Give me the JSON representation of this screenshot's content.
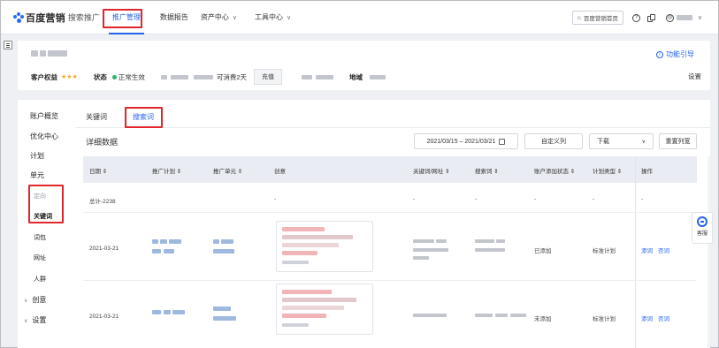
{
  "topnav": {
    "logo": "百度营销",
    "product": "搜索推广",
    "items": [
      {
        "label": "推广管理",
        "active": true
      },
      {
        "label": "数据报告"
      },
      {
        "label": "资产中心"
      },
      {
        "label": "工具中心"
      }
    ],
    "home_button": "百度营销首页",
    "help_icon": "?"
  },
  "account": {
    "benefit_label": "客户权益",
    "stars": "★★★",
    "status_label": "状态",
    "status_value": "正常生效",
    "days_left": "可消费2天",
    "recharge_button": "充值",
    "region_label": "地域",
    "guide_link": "功能引导",
    "settings_link": "设置"
  },
  "sidebar": {
    "items": [
      {
        "label": "账户概览"
      },
      {
        "label": "优化中心"
      },
      {
        "label": "计划"
      },
      {
        "label": "单元"
      },
      {
        "label": "定向"
      },
      {
        "label": "关键词",
        "active": true
      },
      {
        "label": "词包"
      },
      {
        "label": "网址"
      },
      {
        "label": "人群"
      },
      {
        "label": "创意"
      },
      {
        "label": "设置"
      }
    ],
    "caret": "∨"
  },
  "main": {
    "tabs": [
      {
        "label": "关键词"
      },
      {
        "label": "搜索词",
        "active": true
      }
    ],
    "section_title": "详细数据",
    "date_range": "2021/03/15 – 2021/03/21",
    "custom_columns": "自定义列",
    "download": "下载",
    "reset_width": "重置列宽",
    "table": {
      "headers": [
        "日期 ⇕",
        "推广计划 ⇕",
        "推广单元 ⇕",
        "创意",
        "关键词/网址 ⇕",
        "搜索词 ⇕",
        "账户添加状态 ⇕",
        "计划类型 ⇕",
        "操作"
      ],
      "total_label": "总计-2238",
      "dash": "-",
      "rows": [
        {
          "date": "2021-03-21",
          "status": "已添加",
          "plan_type": "标准计划",
          "actions": [
            "添词",
            "否词"
          ]
        },
        {
          "date": "2021-03-21",
          "status": "未添加",
          "plan_type": "标准计划",
          "actions": [
            "添词",
            "否词"
          ]
        }
      ]
    }
  },
  "float_help": "客服",
  "colors": {
    "accent": "#2463eb",
    "highlight_box": "#e0262b",
    "status_dot": "#27b466",
    "stars": "#f5a623"
  }
}
